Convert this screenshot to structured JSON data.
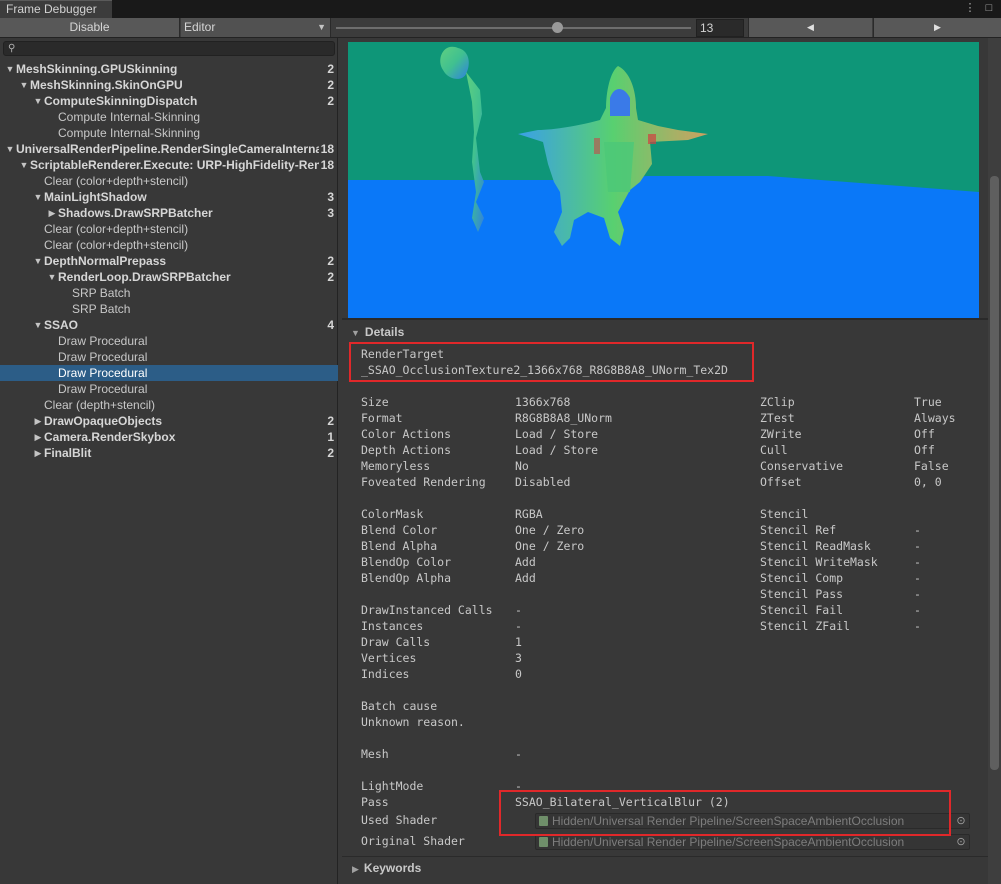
{
  "window": {
    "tab_title": "Frame Debugger",
    "menu_icon": "kebab-menu-icon",
    "maximize_icon": "maximize-icon"
  },
  "toolbar": {
    "disable_label": "Disable",
    "target_label": "Editor",
    "frame_value": "13",
    "prev_icon": "◀",
    "next_icon": "▶",
    "dropdown_icon": "▼",
    "slider_fraction": 0.6
  },
  "tree": {
    "search_icon": "⚲",
    "rows": [
      {
        "label": "MeshSkinning.GPUSkinning",
        "count": "2",
        "depth": 0,
        "expander": "open",
        "bold": true
      },
      {
        "label": "MeshSkinning.SkinOnGPU",
        "count": "2",
        "depth": 1,
        "expander": "open",
        "bold": true
      },
      {
        "label": "ComputeSkinningDispatch",
        "count": "2",
        "depth": 2,
        "expander": "open",
        "bold": true
      },
      {
        "label": "Compute Internal-Skinning",
        "count": "",
        "depth": 3,
        "expander": "none",
        "bold": false
      },
      {
        "label": "Compute Internal-Skinning",
        "count": "",
        "depth": 3,
        "expander": "none",
        "bold": false
      },
      {
        "label": "UniversalRenderPipeline.RenderSingleCameraInternal",
        "count": "18",
        "depth": 0,
        "expander": "open",
        "bold": true
      },
      {
        "label": "ScriptableRenderer.Execute: URP-HighFidelity-Renderer",
        "count": "18",
        "depth": 1,
        "expander": "open",
        "bold": true
      },
      {
        "label": "Clear (color+depth+stencil)",
        "count": "",
        "depth": 2,
        "expander": "none",
        "bold": false
      },
      {
        "label": "MainLightShadow",
        "count": "3",
        "depth": 2,
        "expander": "open",
        "bold": true
      },
      {
        "label": "Shadows.DrawSRPBatcher",
        "count": "3",
        "depth": 3,
        "expander": "closed",
        "bold": true
      },
      {
        "label": "Clear (color+depth+stencil)",
        "count": "",
        "depth": 2,
        "expander": "none",
        "bold": false
      },
      {
        "label": "Clear (color+depth+stencil)",
        "count": "",
        "depth": 2,
        "expander": "none",
        "bold": false
      },
      {
        "label": "DepthNormalPrepass",
        "count": "2",
        "depth": 2,
        "expander": "open",
        "bold": true
      },
      {
        "label": "RenderLoop.DrawSRPBatcher",
        "count": "2",
        "depth": 3,
        "expander": "open",
        "bold": true
      },
      {
        "label": "SRP Batch",
        "count": "",
        "depth": 4,
        "expander": "none",
        "bold": false
      },
      {
        "label": "SRP Batch",
        "count": "",
        "depth": 4,
        "expander": "none",
        "bold": false
      },
      {
        "label": "SSAO",
        "count": "4",
        "depth": 2,
        "expander": "open",
        "bold": true
      },
      {
        "label": "Draw Procedural",
        "count": "",
        "depth": 3,
        "expander": "none",
        "bold": false
      },
      {
        "label": "Draw Procedural",
        "count": "",
        "depth": 3,
        "expander": "none",
        "bold": false
      },
      {
        "label": "Draw Procedural",
        "count": "",
        "depth": 3,
        "expander": "none",
        "bold": false,
        "selected": true
      },
      {
        "label": "Draw Procedural",
        "count": "",
        "depth": 3,
        "expander": "none",
        "bold": false
      },
      {
        "label": "Clear (depth+stencil)",
        "count": "",
        "depth": 2,
        "expander": "none",
        "bold": false
      },
      {
        "label": "DrawOpaqueObjects",
        "count": "2",
        "depth": 2,
        "expander": "closed",
        "bold": true
      },
      {
        "label": "Camera.RenderSkybox",
        "count": "1",
        "depth": 2,
        "expander": "closed",
        "bold": true
      },
      {
        "label": "FinalBlit",
        "count": "2",
        "depth": 2,
        "expander": "closed",
        "bold": true
      }
    ]
  },
  "details": {
    "header": "Details",
    "render_target_label": "RenderTarget",
    "render_target_value": "_SSAO_OcclusionTexture2_1366x768_R8G8B8A8_UNorm_Tex2D",
    "left_props": [
      {
        "label": "Size",
        "value": "1366x768"
      },
      {
        "label": "Format",
        "value": "R8G8B8A8_UNorm"
      },
      {
        "label": "Color Actions",
        "value": "Load / Store"
      },
      {
        "label": "Depth Actions",
        "value": "Load / Store"
      },
      {
        "label": "Memoryless",
        "value": "No"
      },
      {
        "label": "Foveated Rendering",
        "value": "Disabled"
      },
      {
        "label": "",
        "value": ""
      },
      {
        "label": "ColorMask",
        "value": "RGBA"
      },
      {
        "label": "Blend Color",
        "value": "One / Zero"
      },
      {
        "label": "Blend Alpha",
        "value": "One / Zero"
      },
      {
        "label": "BlendOp Color",
        "value": "Add"
      },
      {
        "label": "BlendOp Alpha",
        "value": "Add"
      },
      {
        "label": "",
        "value": ""
      },
      {
        "label": "DrawInstanced Calls",
        "value": "-"
      },
      {
        "label": "Instances",
        "value": "-"
      },
      {
        "label": "Draw Calls",
        "value": "1"
      },
      {
        "label": "Vertices",
        "value": "3"
      },
      {
        "label": "Indices",
        "value": "0"
      },
      {
        "label": "",
        "value": ""
      },
      {
        "label": "Batch cause",
        "value": ""
      },
      {
        "label": "Unknown reason.",
        "value": ""
      },
      {
        "label": "",
        "value": ""
      },
      {
        "label": "Mesh",
        "value": "-"
      },
      {
        "label": "",
        "value": ""
      },
      {
        "label": "LightMode",
        "value": "-"
      },
      {
        "label": "Pass",
        "value": "SSAO_Bilateral_VerticalBlur (2)"
      }
    ],
    "right_props": [
      {
        "label": "ZClip",
        "value": "True"
      },
      {
        "label": "ZTest",
        "value": "Always"
      },
      {
        "label": "ZWrite",
        "value": "Off"
      },
      {
        "label": "Cull",
        "value": "Off"
      },
      {
        "label": "Conservative",
        "value": "False"
      },
      {
        "label": "Offset",
        "value": "0, 0"
      },
      {
        "label": "",
        "value": ""
      },
      {
        "label": "Stencil",
        "value": ""
      },
      {
        "label": "Stencil Ref",
        "value": "-"
      },
      {
        "label": "Stencil ReadMask",
        "value": "-"
      },
      {
        "label": "Stencil WriteMask",
        "value": "-"
      },
      {
        "label": "Stencil Comp",
        "value": "-"
      },
      {
        "label": "Stencil Pass",
        "value": "-"
      },
      {
        "label": "Stencil Fail",
        "value": "-"
      },
      {
        "label": "Stencil ZFail",
        "value": "-"
      }
    ],
    "used_shader_label": "Used Shader",
    "used_shader_value": "Hidden/Universal Render Pipeline/ScreenSpaceAmbientOcclusion",
    "original_shader_label": "Original Shader",
    "original_shader_value": "Hidden/Universal Render Pipeline/ScreenSpaceAmbientOcclusion",
    "picker_icon": "⊙"
  },
  "keywords": {
    "header": "Keywords",
    "icon": "▶"
  },
  "colors": {
    "selection": "#2c5d87",
    "highlight_box": "#e0282a",
    "preview_background": "#0e9678",
    "preview_floor": "#0a78f8"
  }
}
